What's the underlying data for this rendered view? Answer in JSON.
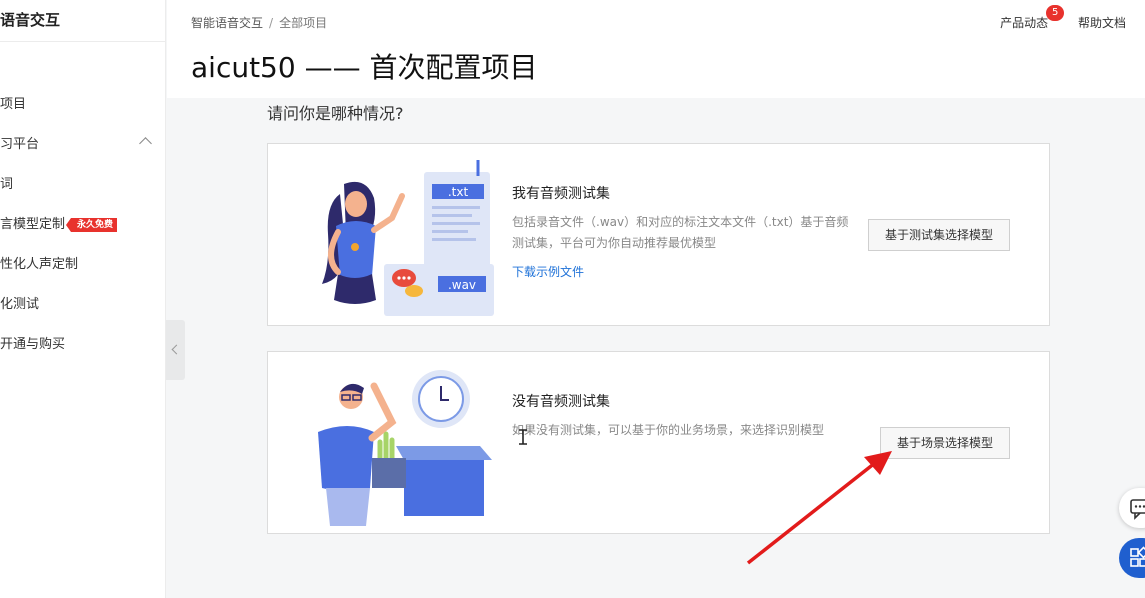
{
  "sidebar": {
    "brand": "语音交互",
    "items": [
      {
        "label": "项目"
      },
      {
        "label": "习平台"
      },
      {
        "label": "词"
      },
      {
        "label": "言模型定制",
        "badge": "永久免费"
      },
      {
        "label": "性化人声定制"
      },
      {
        "label": "化测试"
      },
      {
        "label": "开通与购买"
      }
    ]
  },
  "header": {
    "breadcrumb": [
      "智能语音交互",
      "全部项目"
    ],
    "breadcrumb_sep": "/",
    "title": "aicut50 —— 首次配置项目",
    "links": {
      "news": "产品动态",
      "news_count": "5",
      "help": "帮助文档"
    }
  },
  "main": {
    "question": "请问你是哪种情况?",
    "cards": [
      {
        "title": "我有音频测试集",
        "desc": "包括录音文件（.wav）和对应的标注文本文件（.txt）基于音频测试集，平台可为你自动推荐最优模型",
        "link": "下载示例文件",
        "button": "基于测试集选择模型",
        "file_labels": [
          ".txt",
          ".wav"
        ]
      },
      {
        "title": "没有音频测试集",
        "desc": "如果没有测试集，可以基于你的业务场景，来选择识别模型",
        "button": "基于场景选择模型"
      }
    ]
  },
  "colors": {
    "accent": "#1f72d8",
    "badge": "#e8322d",
    "arrow": "#e21b1b",
    "float_blue": "#1f5fcf"
  },
  "icons": [
    "chevron-up-icon",
    "collapse-left-icon",
    "chat-icon",
    "apps-grid-icon",
    "text-cursor-icon",
    "annotation-arrow"
  ]
}
